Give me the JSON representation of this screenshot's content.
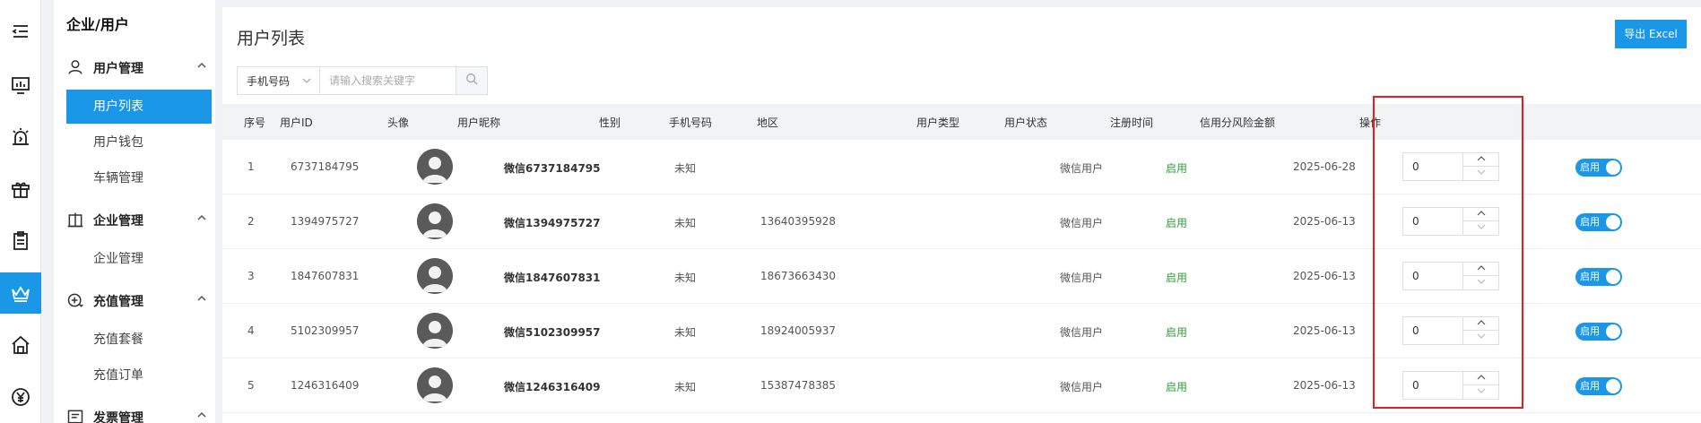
{
  "rail": {
    "items": [
      {
        "icon": "menu-collapse-icon"
      },
      {
        "icon": "monitor-chart-icon"
      },
      {
        "icon": "alarm-icon"
      },
      {
        "icon": "gift-icon"
      },
      {
        "icon": "clipboard-icon"
      },
      {
        "icon": "crown-icon",
        "active": true
      },
      {
        "icon": "home-icon"
      },
      {
        "icon": "yen-icon"
      }
    ]
  },
  "submenu": {
    "title": "企业/用户",
    "groups": [
      {
        "label": "用户管理",
        "icon": "user-icon",
        "items": [
          "用户列表",
          "用户钱包",
          "车辆管理"
        ]
      },
      {
        "label": "企业管理",
        "icon": "building-icon",
        "items": [
          "企业管理"
        ]
      },
      {
        "label": "充值管理",
        "icon": "recharge-icon",
        "items": [
          "充值套餐",
          "充值订单"
        ]
      },
      {
        "label": "发票管理",
        "icon": "invoice-icon",
        "items": []
      }
    ],
    "active_item": "用户列表"
  },
  "header": {
    "title": "用户列表",
    "export_label": "导出 Excel"
  },
  "filter": {
    "select_value": "手机号码",
    "search_placeholder": "请输入搜索关键字"
  },
  "table": {
    "columns": [
      "序号",
      "用户ID",
      "头像",
      "用户昵称",
      "性别",
      "手机号码",
      "地区",
      "用户类型",
      "用户状态",
      "注册时间",
      "信用分风险金额",
      "操作"
    ],
    "rows": [
      {
        "index": "1",
        "user_id": "6737184795",
        "nickname": "微信6737184795",
        "gender": "未知",
        "phone": "",
        "region": "",
        "type": "微信用户",
        "status": "启用",
        "registered": "2025-06-28",
        "risk_amount": "0",
        "switch_label": "启用"
      },
      {
        "index": "2",
        "user_id": "1394975727",
        "nickname": "微信1394975727",
        "gender": "未知",
        "phone": "13640395928",
        "region": "",
        "type": "微信用户",
        "status": "启用",
        "registered": "2025-06-13",
        "risk_amount": "0",
        "switch_label": "启用"
      },
      {
        "index": "3",
        "user_id": "1847607831",
        "nickname": "微信1847607831",
        "gender": "未知",
        "phone": "18673663430",
        "region": "",
        "type": "微信用户",
        "status": "启用",
        "registered": "2025-06-13",
        "risk_amount": "0",
        "switch_label": "启用"
      },
      {
        "index": "4",
        "user_id": "5102309957",
        "nickname": "微信5102309957",
        "gender": "未知",
        "phone": "18924005937",
        "region": "",
        "type": "微信用户",
        "status": "启用",
        "registered": "2025-06-13",
        "risk_amount": "0",
        "switch_label": "启用"
      },
      {
        "index": "5",
        "user_id": "1246316409",
        "nickname": "微信1246316409",
        "gender": "未知",
        "phone": "15387478385",
        "region": "",
        "type": "微信用户",
        "status": "启用",
        "registered": "2025-06-13",
        "risk_amount": "0",
        "switch_label": "启用"
      }
    ]
  },
  "colors": {
    "accent": "#1a97e6",
    "status_green": "#2e9d3a",
    "highlight_red": "#e02020"
  }
}
